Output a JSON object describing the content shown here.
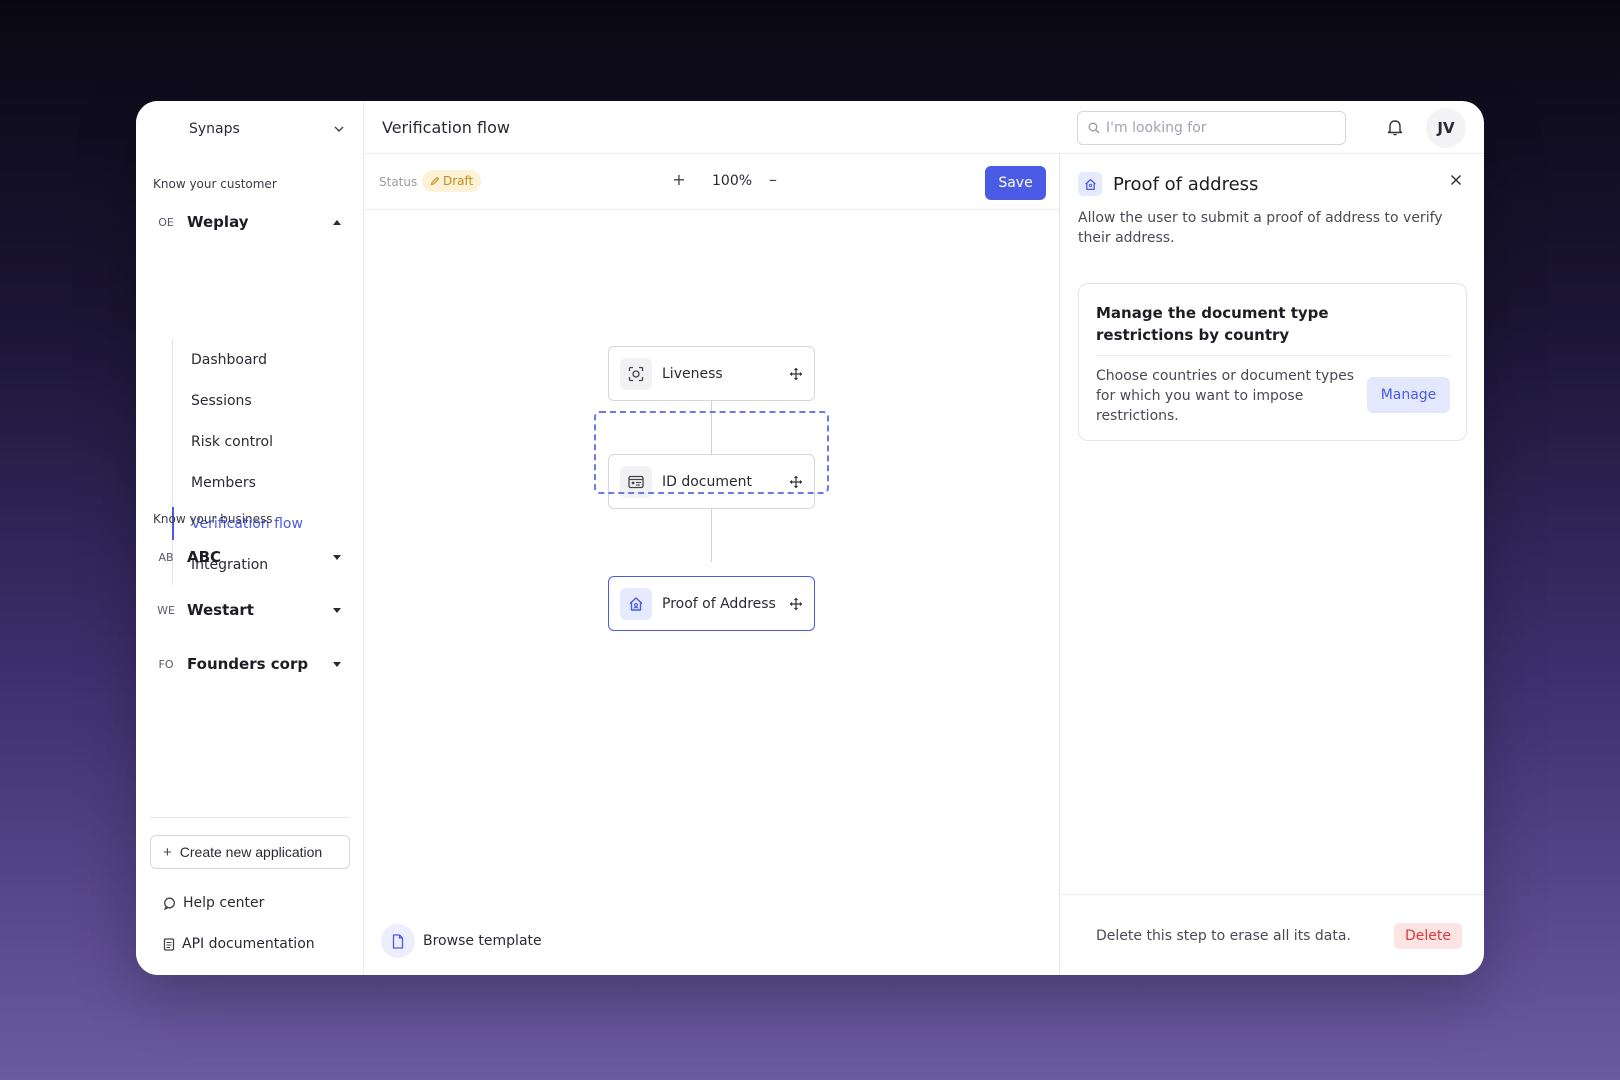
{
  "sidebar": {
    "org_name": "Synaps",
    "kyc_label": "Know your customer",
    "kyb_label": "Know your business",
    "kyc_app": {
      "abbr": "OE",
      "name": "Weplay"
    },
    "nav": [
      "Dashboard",
      "Sessions",
      "Risk control",
      "Members",
      "Verification flow",
      "Integration"
    ],
    "active_nav": "Verification flow",
    "kyb_apps": [
      {
        "abbr": "AB",
        "name": "ABC"
      },
      {
        "abbr": "WE",
        "name": "Westart"
      },
      {
        "abbr": "FO",
        "name": "Founders corp"
      }
    ],
    "create_label": "Create new application",
    "help_label": "Help center",
    "api_label": "API documentation"
  },
  "header": {
    "title": "Verification flow",
    "search_placeholder": "I'm looking for",
    "avatar_initials": "JV"
  },
  "toolbar": {
    "status_label": "Status",
    "status_value": "Draft",
    "zoom_in": "+",
    "zoom": "100%",
    "zoom_out": "–",
    "save_label": "Save"
  },
  "flow": {
    "steps": [
      {
        "label": "Liveness",
        "icon": "liveness-icon"
      },
      {
        "label": "ID document",
        "icon": "id-card-icon"
      },
      {
        "label": "Proof of Address",
        "icon": "home-icon"
      }
    ],
    "selected_step": "Proof of Address",
    "browse_label": "Browse template"
  },
  "panel": {
    "title": "Proof of address",
    "description": "Allow the user to submit a proof of address to verify their address.",
    "card_title": "Manage the document type restrictions by country",
    "card_text": "Choose countries or document types for which you want to impose restrictions.",
    "manage_label": "Manage",
    "footer_text": "Delete this step to erase all its data.",
    "delete_label": "Delete"
  },
  "colors": {
    "accent": "#4a5be6",
    "draft_bg": "#fdf1d6",
    "draft_text": "#c78a1a",
    "danger": "#d93a3a"
  }
}
